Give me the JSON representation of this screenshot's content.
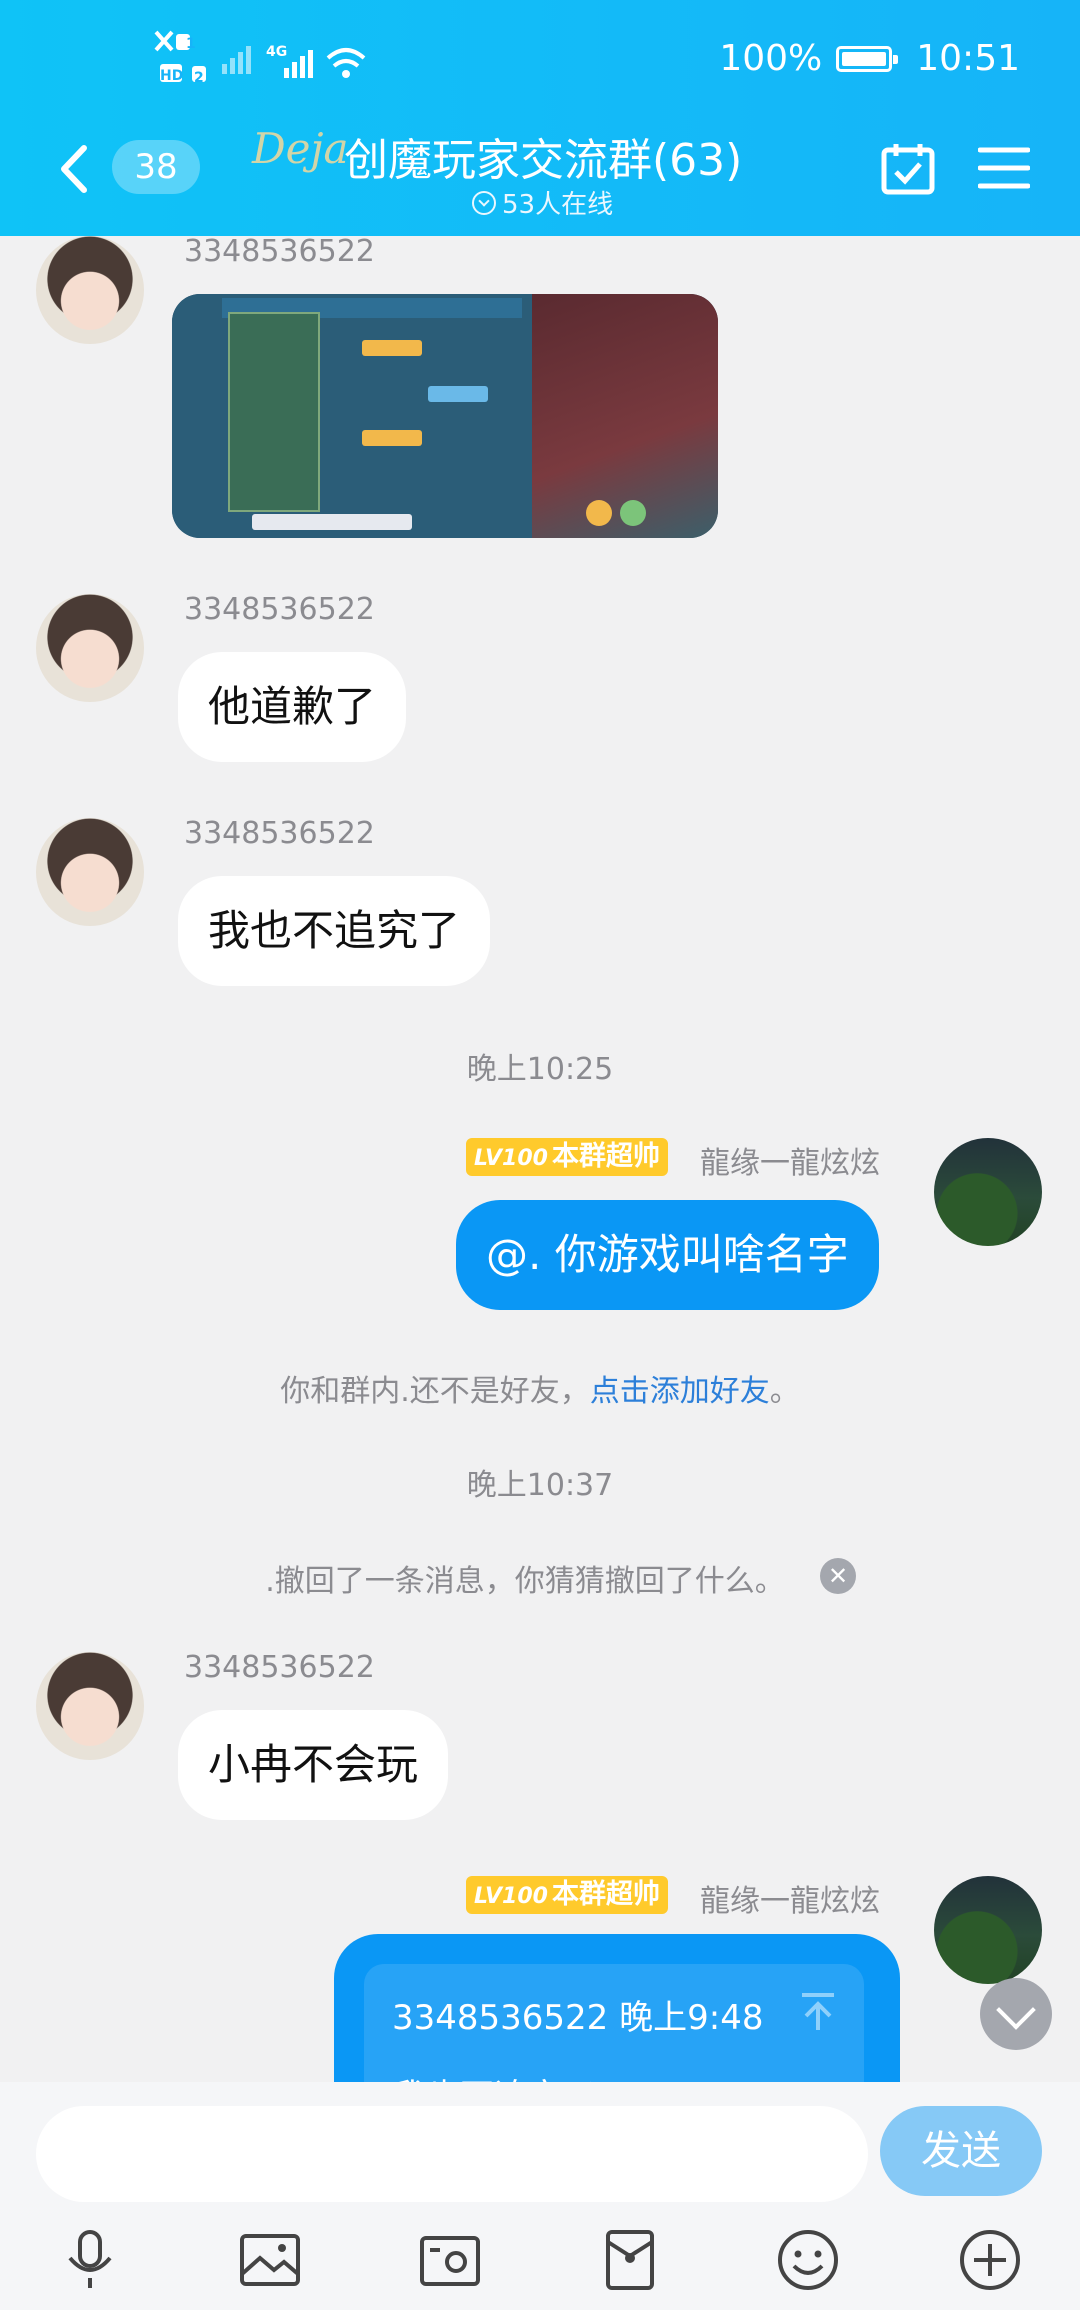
{
  "status_bar": {
    "network_label_1": "1",
    "network_label_hd": "HD",
    "network_label_2": "2",
    "network_4g": "4G",
    "battery": "100%",
    "time": "10:51"
  },
  "header": {
    "unread_count": "38",
    "logo_text": "Deja",
    "group_title": "创魔玩家交流群(63)",
    "online_status": "53人在线"
  },
  "messages": [
    {
      "sender": "3348536522",
      "type": "image",
      "image_alt": "游戏聊天截图"
    },
    {
      "sender": "3348536522",
      "type": "text",
      "text": "他道歉了"
    },
    {
      "sender": "3348536522",
      "type": "text",
      "text": "我也不追究了"
    },
    {
      "type": "time",
      "text": "晚上10:25"
    },
    {
      "sender": "龍缘一龍炫炫",
      "type": "text",
      "self": true,
      "title_tag_level": "LV100",
      "title_tag": "本群超帅",
      "text": "@. 你游戏叫啥名字"
    },
    {
      "type": "system",
      "text": "你和群内.还不是好友，",
      "link": "点击添加好友",
      "suffix": "。"
    },
    {
      "type": "time",
      "text": "晚上10:37"
    },
    {
      "type": "system",
      "text": ".撤回了一条消息，你猜猜撤回了什么。"
    },
    {
      "sender": "3348536522",
      "type": "text",
      "text": "小冉不会玩"
    },
    {
      "sender": "龍缘一龍炫炫",
      "type": "quote",
      "self": true,
      "title_tag_level": "LV100",
      "title_tag": "本群超帅",
      "quote_header": "3348536522 晚上9:48",
      "quote_text": "我也不追究了"
    }
  ],
  "input": {
    "placeholder": "",
    "send_label": "发送"
  },
  "toolbar": {
    "icons": [
      "microphone-icon",
      "image-icon",
      "camera-icon",
      "red-packet-icon",
      "emoji-icon",
      "plus-icon"
    ]
  },
  "colors": {
    "header_bg": "#16b4f8",
    "self_bubble": "#0a97f5",
    "tag_bg": "#ffca2c",
    "link": "#2c7fd9"
  }
}
